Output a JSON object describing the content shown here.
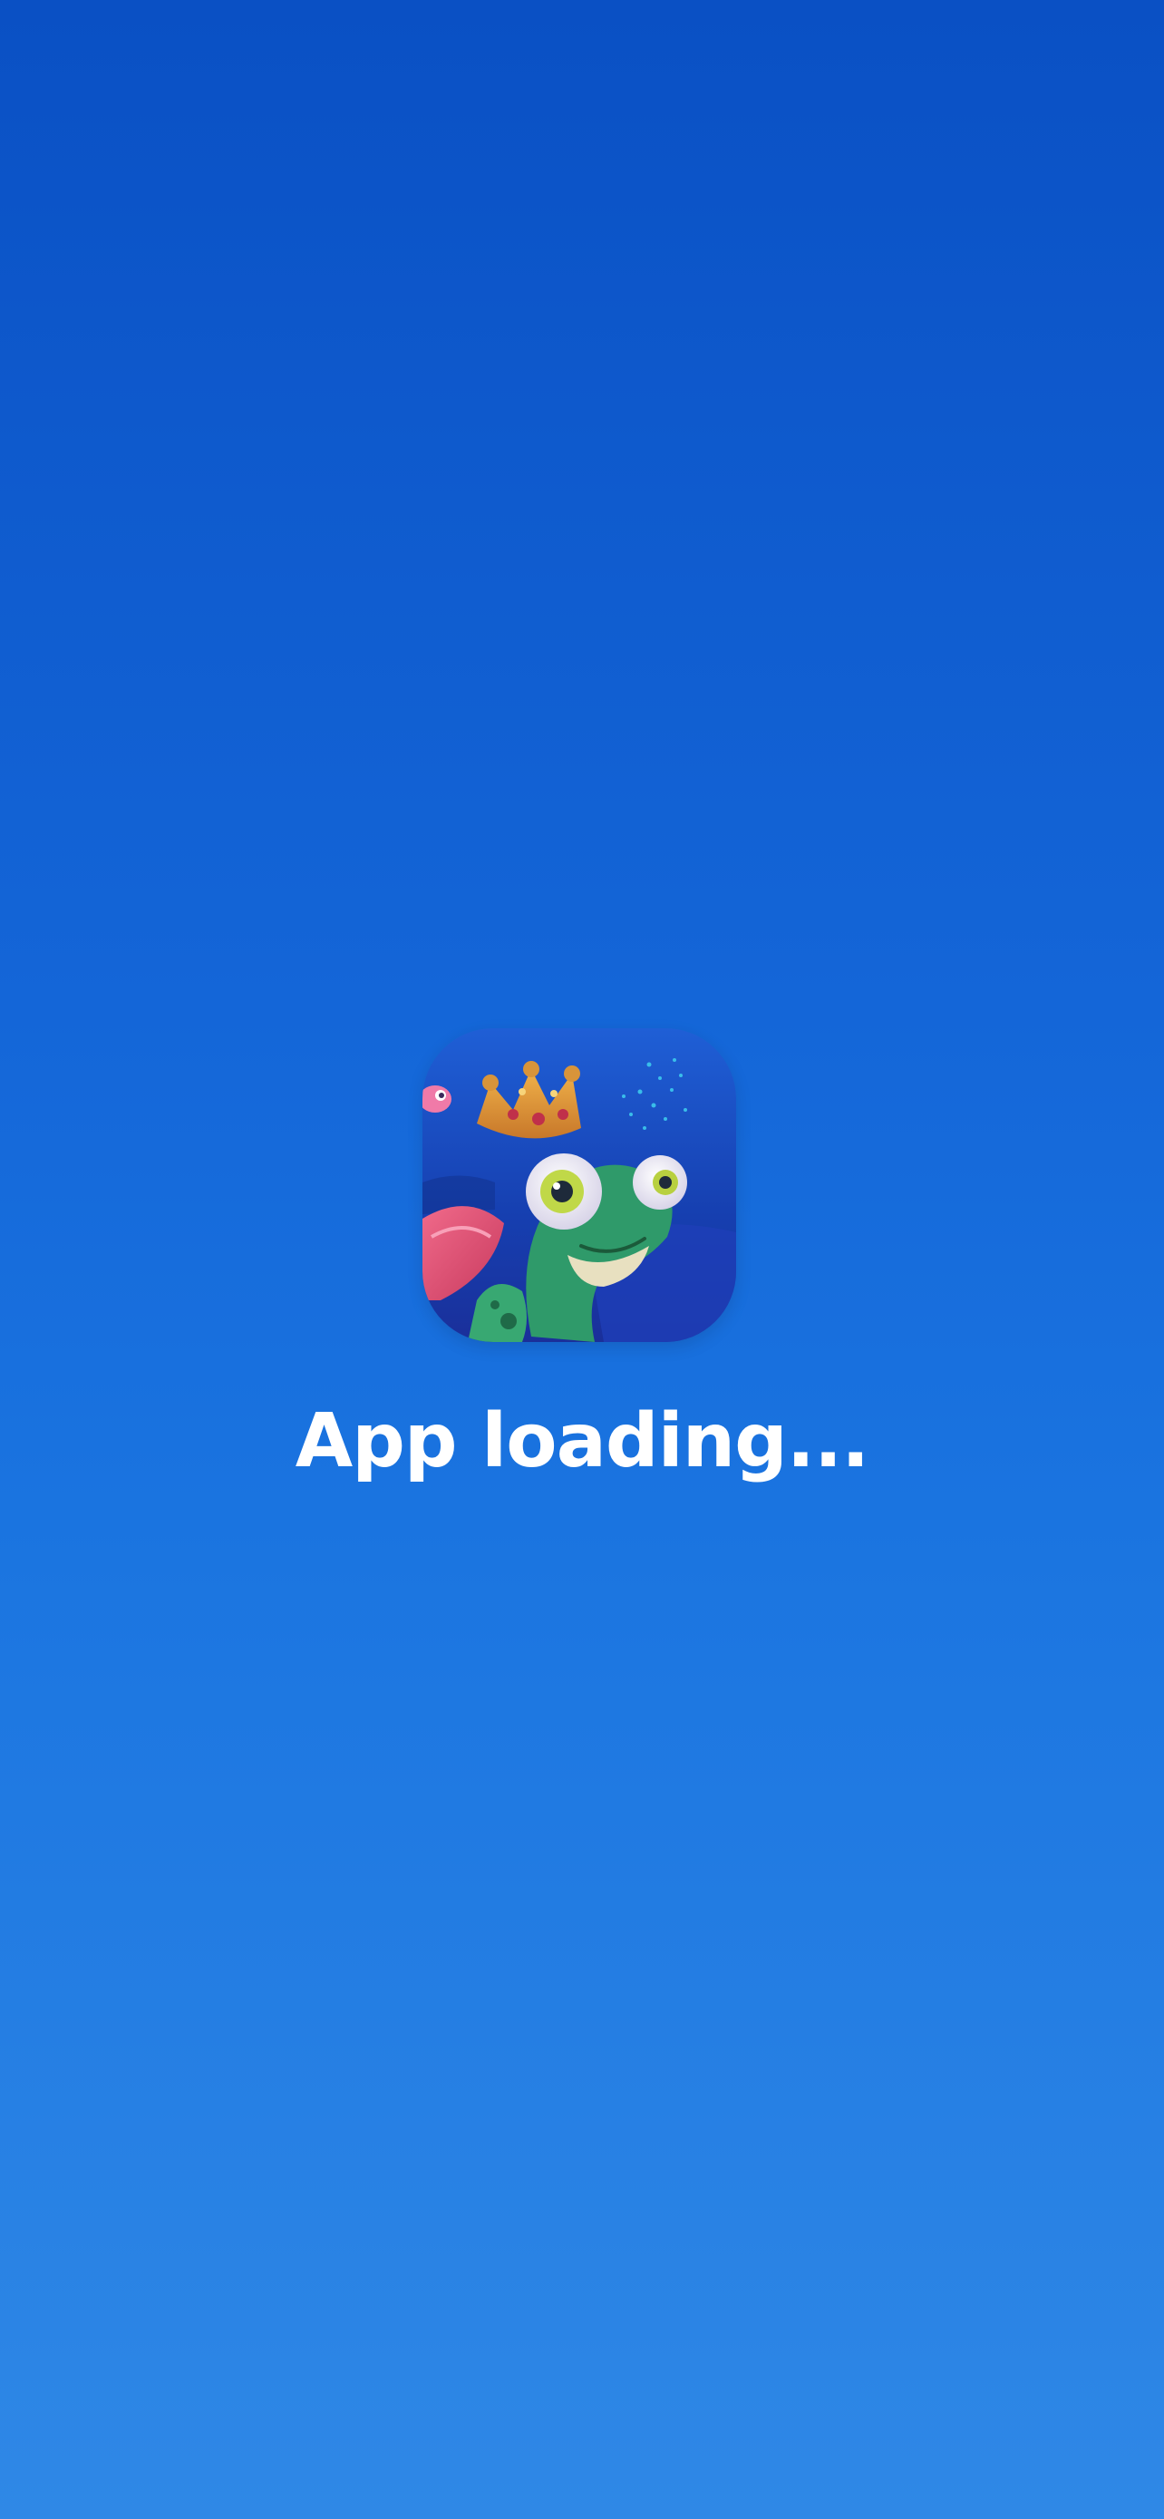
{
  "splash": {
    "loading_label": "App loading...",
    "icon": "frog-king-app-icon"
  },
  "colors": {
    "background_top": "#0a50c4",
    "background_bottom": "#2f88e6",
    "text": "#ffffff"
  }
}
